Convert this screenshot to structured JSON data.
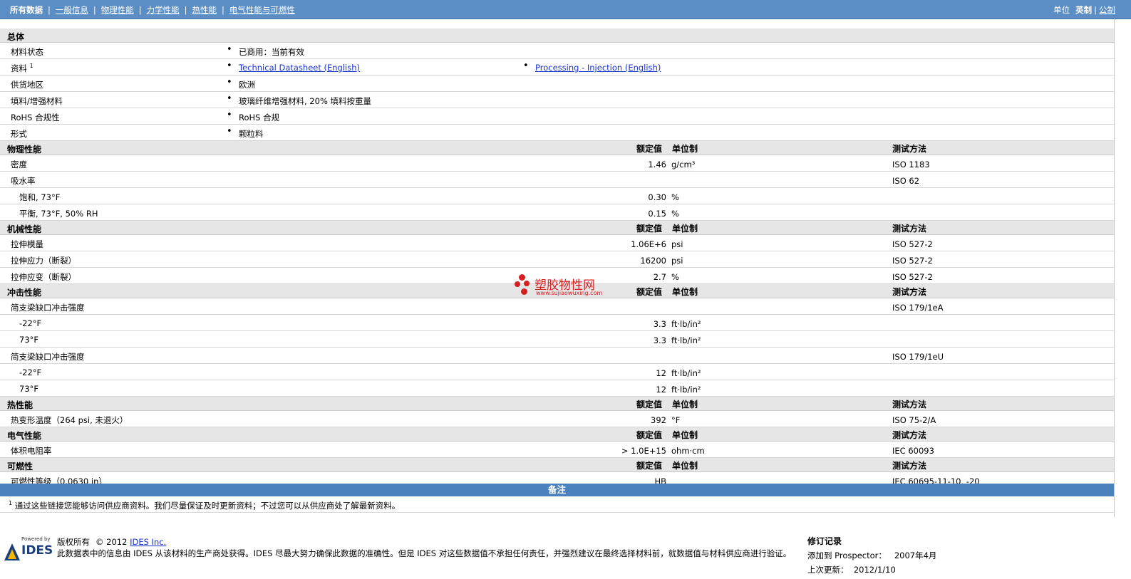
{
  "nav": {
    "tabs": [
      "所有数据",
      "一般信息",
      "物理性能",
      "力学性能",
      "热性能",
      "电气性能与可燃性"
    ],
    "unit_label": "单位",
    "unit_english": "英制",
    "unit_metric": "公制"
  },
  "general": {
    "title": "总体",
    "rows": [
      {
        "label": "材料状态",
        "values": [
          "已商用：当前有效"
        ]
      },
      {
        "label": "资料",
        "sup": "1",
        "links": [
          "Technical Datasheet (English)",
          "Processing - Injection (English)"
        ]
      },
      {
        "label": "供货地区",
        "values": [
          "欧洲"
        ]
      },
      {
        "label": "填料/增强材料",
        "values": [
          "玻璃纤维增强材料, 20% 填料按重量"
        ]
      },
      {
        "label": "RoHS 合规性",
        "values": [
          "RoHS 合规"
        ]
      },
      {
        "label": "形式",
        "values": [
          "颗粒料"
        ]
      }
    ]
  },
  "headers": {
    "value": "额定值",
    "unit": "单位制",
    "method": "测试方法"
  },
  "sections": [
    {
      "title": "物理性能",
      "rows": [
        {
          "label": "密度",
          "value": "1.46",
          "unit": "g/cm³",
          "method": "ISO 1183"
        },
        {
          "label": "吸水率",
          "value": "",
          "unit": "",
          "method": "ISO 62"
        },
        {
          "label": "饱和, 73°F",
          "sub": true,
          "value": "0.30",
          "unit": "%",
          "method": ""
        },
        {
          "label": "平衡, 73°F, 50% RH",
          "sub": true,
          "value": "0.15",
          "unit": "%",
          "method": ""
        }
      ]
    },
    {
      "title": "机械性能",
      "rows": [
        {
          "label": "拉伸模量",
          "value": "1.06E+6",
          "unit": "psi",
          "method": "ISO 527-2"
        },
        {
          "label": "拉伸应力（断裂）",
          "value": "16200",
          "unit": "psi",
          "method": "ISO 527-2"
        },
        {
          "label": "拉伸应变（断裂）",
          "value": "2.7",
          "unit": "%",
          "method": "ISO 527-2"
        }
      ]
    },
    {
      "title": "冲击性能",
      "rows": [
        {
          "label": "简支梁缺口冲击强度",
          "value": "",
          "unit": "",
          "method": "ISO 179/1eA"
        },
        {
          "label": "-22°F",
          "sub": true,
          "value": "3.3",
          "unit": "ft·lb/in²",
          "method": ""
        },
        {
          "label": "73°F",
          "sub": true,
          "value": "3.3",
          "unit": "ft·lb/in²",
          "method": ""
        },
        {
          "label": "简支梁缺口冲击强度",
          "value": "",
          "unit": "",
          "method": "ISO 179/1eU"
        },
        {
          "label": "-22°F",
          "sub": true,
          "value": "12",
          "unit": "ft·lb/in²",
          "method": ""
        },
        {
          "label": "73°F",
          "sub": true,
          "value": "12",
          "unit": "ft·lb/in²",
          "method": ""
        }
      ]
    },
    {
      "title": "热性能",
      "rows": [
        {
          "label": "热变形温度（264 psi, 未退火）",
          "value": "392",
          "unit": "°F",
          "method": "ISO 75-2/A"
        }
      ]
    },
    {
      "title": "电气性能",
      "rows": [
        {
          "label": "体积电阻率",
          "value": "> 1.0E+15",
          "unit": "ohm·cm",
          "method": "IEC 60093"
        }
      ]
    },
    {
      "title": "可燃性",
      "rows": [
        {
          "label": "可燃性等级（0.0630 in）",
          "value": "HB",
          "unit": "",
          "method": "IEC 60695-11-10, -20"
        }
      ]
    }
  ],
  "remarks": {
    "title": "备注",
    "sup": "1",
    "text": "通过这些链接您能够访问供应商资料。我们尽量保证及时更新资料；不过您可以从供应商处了解最新资料。"
  },
  "footer": {
    "logo_powered": "Powered by",
    "logo_name": "IDES",
    "copyright_prefix": "版权所有",
    "copyright_year": "© 2012",
    "copyright_link": "IDES Inc.",
    "disclaimer": "此数据表中的信息由  IDES 从该材料的生产商处获得。IDES 尽最大努力确保此数据的准确性。但是  IDES 对这些数据值不承担任何责任，并强烈建议在最终选择材料前，就数据值与材料供应商进行验证。",
    "revision_title": "修订记录",
    "added_label": "添加到",
    "added_target": "Prospector：",
    "added_date": "2007年4月",
    "updated_label": "上次更新：",
    "updated_date": "2012/1/10"
  },
  "watermark": {
    "text": "塑胶物性网",
    "url": "www.sujiaowuxing.com"
  },
  "colors": {
    "nav_bar": "#5b8ec4",
    "section_bg": "#e6e6e6",
    "remarks_bar": "#4b82bd",
    "link": "#1a33cc",
    "watermark": "#d42020"
  }
}
